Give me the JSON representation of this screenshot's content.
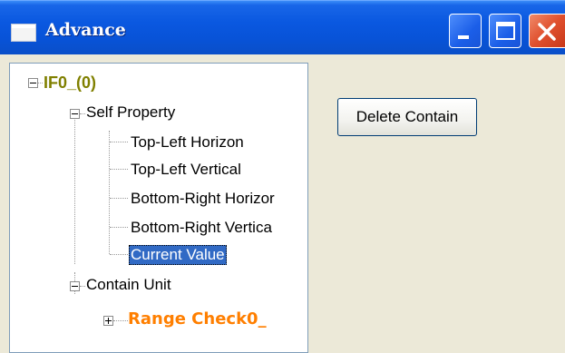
{
  "window": {
    "title": "Advance"
  },
  "tree": {
    "root": "IF0_(0)",
    "self_property": {
      "label": "Self Property",
      "children": [
        "Top-Left Horizon",
        "Top-Left Vertical",
        "Bottom-Right Horizor",
        "Bottom-Right Vertica",
        "Current Value"
      ],
      "selected": "Current Value"
    },
    "contain_unit": {
      "label": "Contain Unit",
      "children": [
        "Range Check0_"
      ]
    }
  },
  "actions": {
    "delete_contain": "Delete Contain"
  },
  "colors": {
    "root_label": "#808000",
    "contain_child_label": "#ff7f00",
    "selection": "#316ac5"
  }
}
